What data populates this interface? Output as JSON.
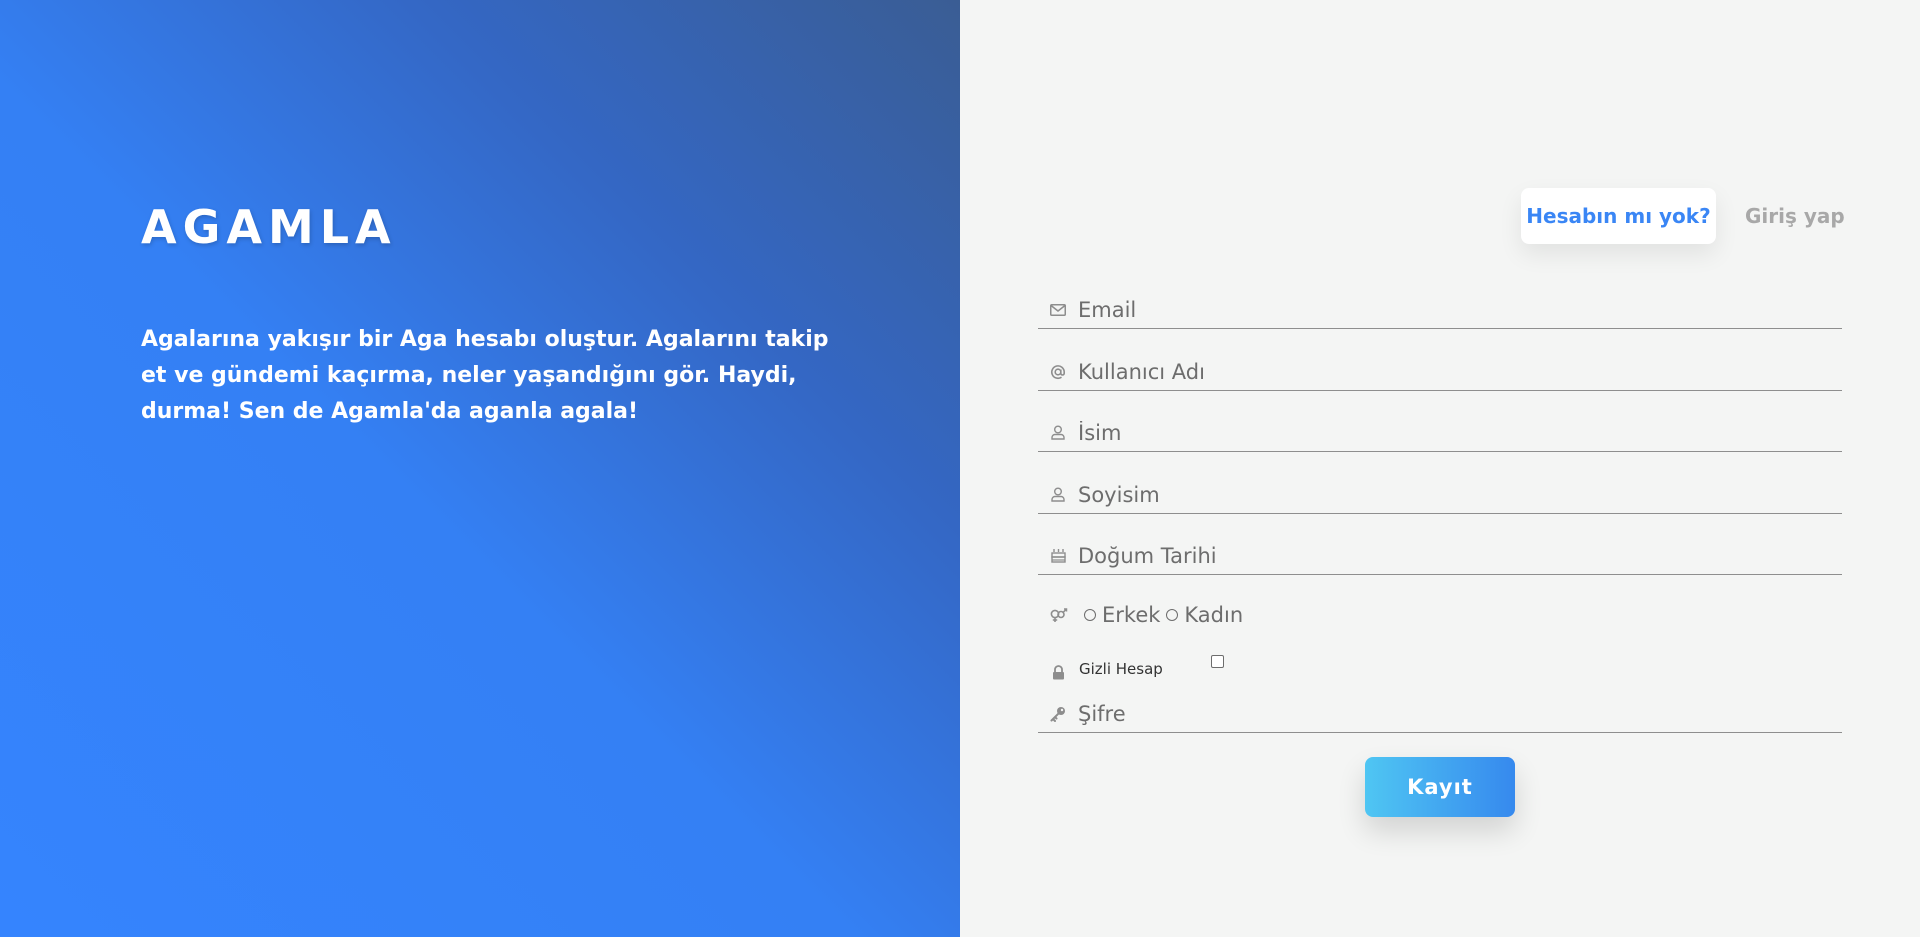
{
  "brand": {
    "name": "AGAMLA"
  },
  "hero": {
    "tagline": "Agalarına yakışır bir Aga hesabı oluştur. Agalarını takip et ve gündemi kaçırma, neler yaşandığını gör. Haydi, durma! Sen de Agamla'da aganla agala!"
  },
  "tabs": {
    "signup": "Hesabın mı yok?",
    "login": "Giriş yap"
  },
  "form": {
    "email": {
      "placeholder": "Email",
      "icon": "envelope-icon"
    },
    "username": {
      "placeholder": "Kullanıcı Adı",
      "icon": "at-icon"
    },
    "first_name": {
      "placeholder": "İsim",
      "icon": "user-icon"
    },
    "last_name": {
      "placeholder": "Soyisim",
      "icon": "user-icon"
    },
    "birthdate": {
      "placeholder": "Doğum Tarihi",
      "icon": "cake-icon"
    },
    "gender": {
      "icon": "gender-icon",
      "options": [
        "Erkek",
        "Kadın"
      ]
    },
    "private_account": {
      "label": "Gizli Hesap",
      "icon": "lock-icon",
      "checked": false
    },
    "password": {
      "placeholder": "Şifre",
      "icon": "key-icon"
    },
    "submit": "Kayıt"
  },
  "colors": {
    "accent": "#3a86f5",
    "hero_gradient_start": "#3584fe",
    "hero_gradient_end": "#3a5d94",
    "button_gradient_start": "#4fc6f3",
    "button_gradient_end": "#3689ee",
    "background": "#f4f5f4"
  }
}
